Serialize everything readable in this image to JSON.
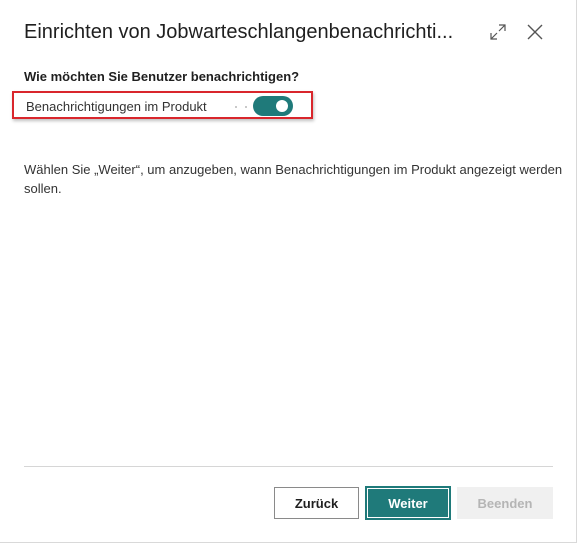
{
  "dialog": {
    "title": "Einrichten von Jobwarteschlangenbenachrichti...",
    "expand_icon": "expand-diagonal-icon",
    "close_icon": "close-x-icon"
  },
  "form": {
    "question": "Wie möchten Sie Benutzer benachrichtigen?",
    "field_label": "Benachrichtigungen im Produkt",
    "toggle_on": true,
    "description": "Wählen Sie „Weiter“, um anzugeben, wann Benachrichtigungen im Produkt angezeigt werden sollen."
  },
  "footer": {
    "back_label": "Zurück",
    "next_label": "Weiter",
    "finish_label": "Beenden"
  },
  "colors": {
    "accent": "#1f7a7a",
    "highlight_border": "#d9262c",
    "disabled_bg": "#f0f0f0",
    "disabled_text": "#b5b5b5"
  }
}
